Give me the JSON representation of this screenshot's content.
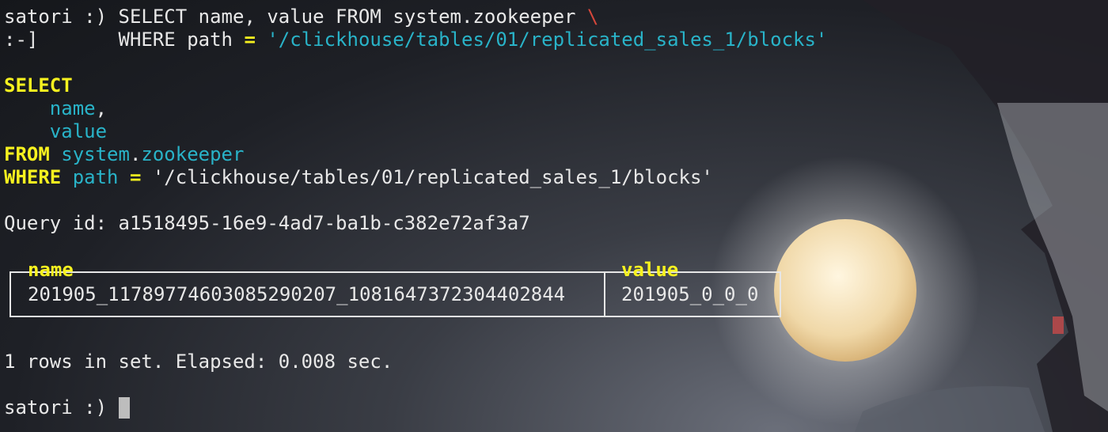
{
  "prompt_user": "satori :)",
  "command_line1": " SELECT name, value FROM system.zookeeper",
  "continuation_prompt": ":-]",
  "command_line2_pre": "       WHERE path ",
  "command_path_literal": "'/clickhouse/tables/01/replicated_sales_1/blocks'",
  "formatted": {
    "select_kw": "SELECT",
    "col1": "name",
    "col2": "value",
    "from_kw": "FROM",
    "table_db": "system",
    "table_name": "zookeeper",
    "where_kw": "WHERE",
    "where_field": "path",
    "where_op": "=",
    "where_value": "'/clickhouse/tables/01/replicated_sales_1/blocks'"
  },
  "query_id_label": "Query id:",
  "query_id": "a1518495-16e9-4ad7-ba1b-c382e72af3a7",
  "result": {
    "headers": [
      "name",
      "value"
    ],
    "rows": [
      [
        "201905_11789774603085290207_1081647372304402844",
        "201905_0_0_0"
      ]
    ]
  },
  "summary": "1 rows in set. Elapsed: 0.008 sec.",
  "final_prompt": "satori :)",
  "colors": {
    "keyword": "#f7f21f",
    "identifier": "#29b3c8",
    "backslash": "#d6473b",
    "text": "#e8e8e8"
  }
}
